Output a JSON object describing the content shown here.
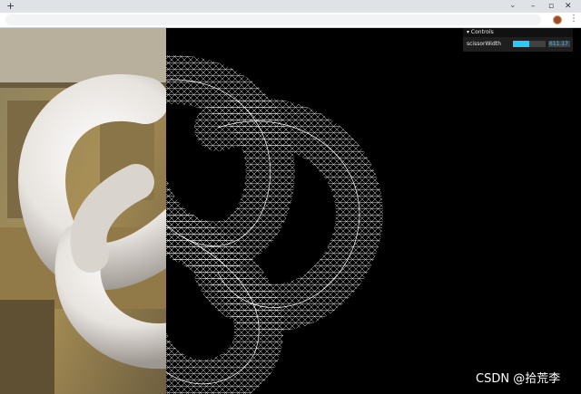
{
  "browser": {
    "new_tab_icon": "plus-icon",
    "tab_search_icon": "chevron-down-icon",
    "window_controls": [
      "minimize-icon",
      "maximize-icon",
      "close-icon"
    ]
  },
  "gui": {
    "title": "Controls",
    "controls": [
      {
        "label": "scissorWidth",
        "value": "611.17",
        "fill_fraction": 0.5
      }
    ]
  },
  "scene": {
    "left_half": "photo-background-with-solid-torus-knot",
    "right_half": "black-background-with-wireframe-torus-knot",
    "split_fraction": 0.285,
    "colors": {
      "mesh": "#ffffff",
      "right_background": "#000000",
      "accent": "#2cc9ff"
    }
  },
  "watermark": "CSDN @拾荒李"
}
